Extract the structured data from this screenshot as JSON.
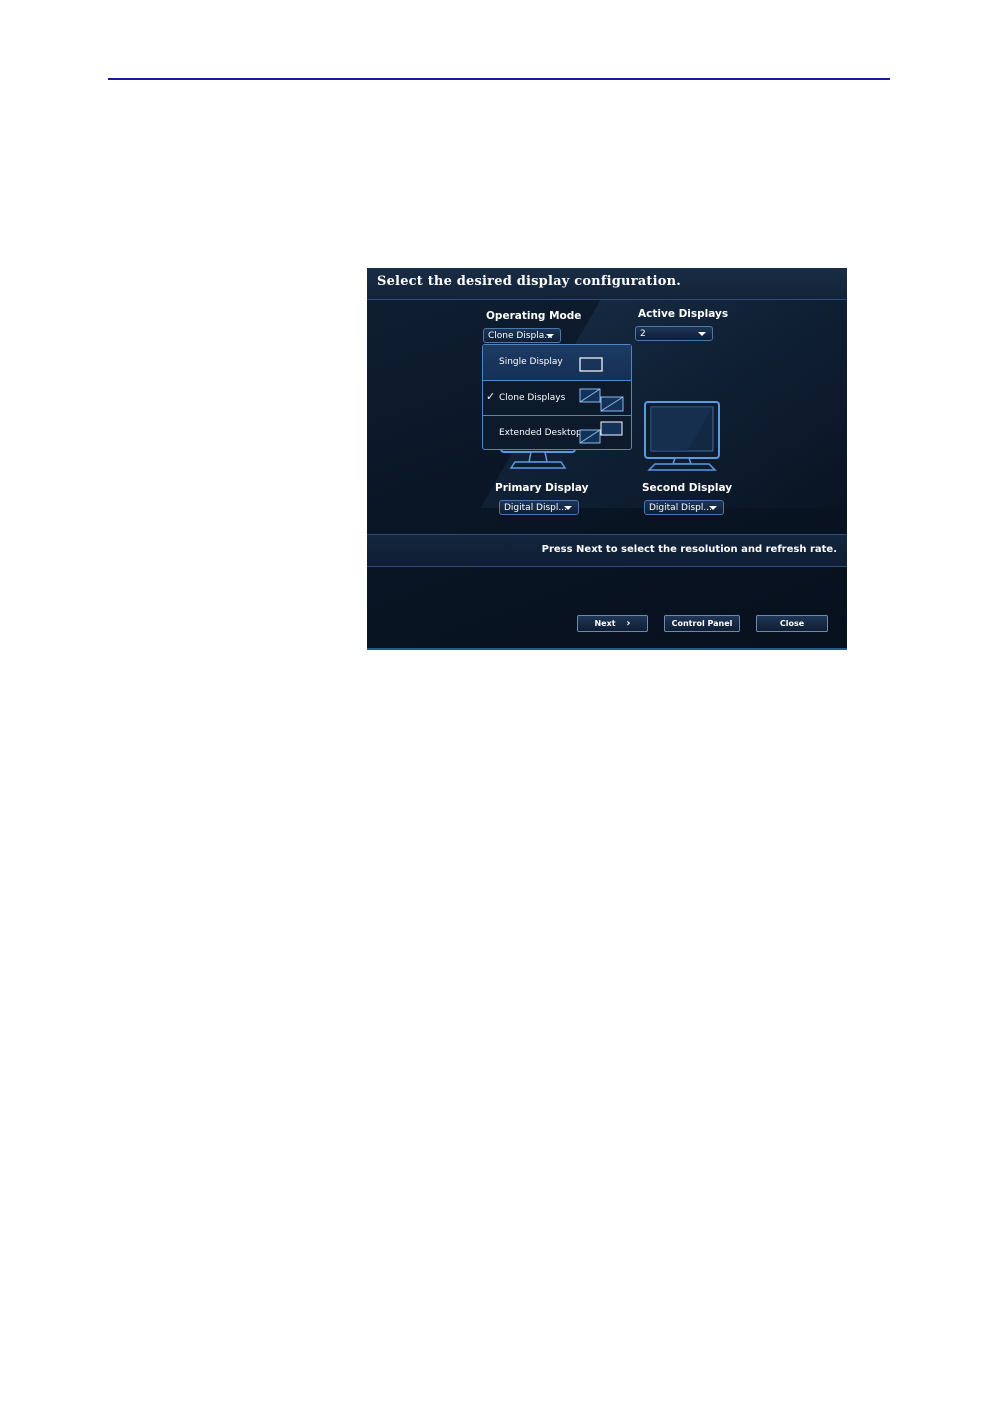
{
  "dialog": {
    "title": "Select the desired display configuration.",
    "operating_mode": {
      "label": "Operating Mode",
      "value": "Clone Displa...",
      "options": [
        {
          "label": "Single Display",
          "icon": "single-display-icon"
        },
        {
          "label": "Clone Displays",
          "icon": "clone-displays-icon",
          "checked": true
        },
        {
          "label": "Extended Desktop",
          "icon": "extended-desktop-icon"
        }
      ]
    },
    "active_displays": {
      "label": "Active Displays",
      "value": "2"
    },
    "primary_display": {
      "label": "Primary Display",
      "value": "Digital Displ..."
    },
    "second_display": {
      "label": "Second Display",
      "value": "Digital Displ..."
    },
    "status_message": "Press Next to select the resolution and refresh rate.",
    "buttons": {
      "next": "Next",
      "control_panel": "Control Panel",
      "close": "Close"
    }
  },
  "colors": {
    "page_rule": "#1a1a9c",
    "dialog_bg": "#0a1626",
    "accent_border": "#4f86c8"
  }
}
